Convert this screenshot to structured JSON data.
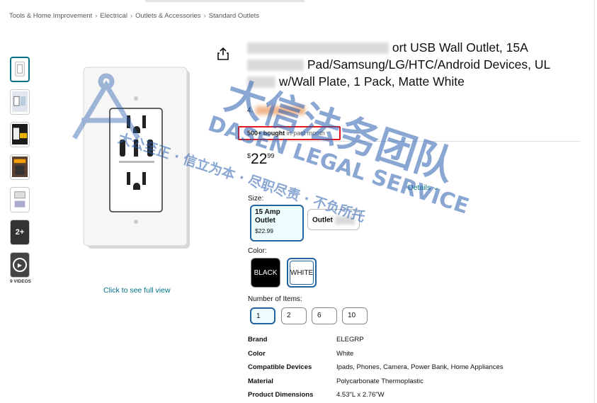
{
  "breadcrumb": [
    "Tools & Home Improvement",
    "Electrical",
    "Outlets & Accessories",
    "Standard Outlets"
  ],
  "breadcrumb_sep": "›",
  "thumbnails": {
    "more_label": "2+",
    "videos_label": "9 VIDEOS"
  },
  "gallery": {
    "full_view_link": "Click to see full view"
  },
  "product": {
    "title_line1": "ort USB Wall Outlet, 15A",
    "title_line2": "Pad/Samsung/LG/HTC/Android Devices, UL",
    "title_line3": "w/Wall Plate, 1 Pack, Matte White",
    "rating_value": "4.",
    "bought_bold": "500+ bought",
    "bought_rest": " in past month",
    "price_currency": "$",
    "price_whole": "22",
    "price_fraction": "99",
    "details_link": "Details"
  },
  "size": {
    "label": "Size:",
    "options": [
      {
        "label": "15 Amp Outlet",
        "price": "$22.99"
      },
      {
        "label": "Outlet"
      }
    ]
  },
  "color": {
    "label": "Color:",
    "options": [
      "BLACK",
      "WHITE"
    ]
  },
  "items": {
    "label": "Number of Items:",
    "options": [
      "1",
      "2",
      "6",
      "10"
    ]
  },
  "specs": [
    {
      "key": "Brand",
      "value": "ELEGRP"
    },
    {
      "key": "Color",
      "value": "White"
    },
    {
      "key": "Compatible Devices",
      "value": "Ipads, Phones, Camera, Power Bank, Home Appliances"
    },
    {
      "key": "Material",
      "value": "Polycarbonate Thermoplastic"
    },
    {
      "key": "Product Dimensions",
      "value": "4.53\"L x 2.76\"W"
    }
  ],
  "watermark": {
    "chinese_main": "大信法务团队",
    "english": "DASEN LEGAL SERVICE",
    "motto": "大公至正 · 信立为本 · 尽职尽责 · 不负所托"
  },
  "colors": {
    "link": "#007185",
    "selected_border": "#2162a1",
    "highlight_box": "#e3171e",
    "watermark": "#2b5fb0"
  }
}
